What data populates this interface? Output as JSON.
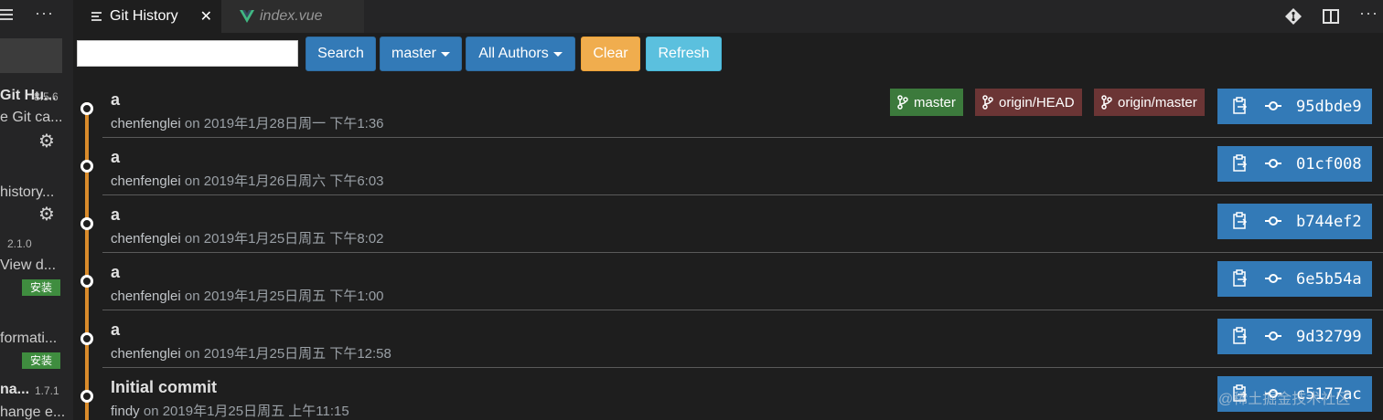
{
  "sidebar": {
    "extensions": [
      {
        "name": "Git Hu...",
        "version": "8.5.6",
        "description": "e Git ca...",
        "has_gear": true
      },
      {
        "name": "",
        "version": "",
        "description": "history...",
        "has_gear": true
      },
      {
        "name": "",
        "version": "2.1.0",
        "description": "View d...",
        "install_label": "安装"
      },
      {
        "name": "",
        "version": "",
        "description": "formati...",
        "install_label": "安装"
      },
      {
        "name": "na...",
        "version": "1.7.1",
        "description": "hange e..."
      }
    ]
  },
  "tabs": [
    {
      "label": "Git History",
      "active": true,
      "icon": "lines-icon",
      "closable": true
    },
    {
      "label": "index.vue",
      "active": false,
      "icon": "vue-icon"
    }
  ],
  "toolbar": {
    "search_value": "",
    "search_label": "Search",
    "branch_label": "master",
    "authors_label": "All Authors",
    "clear_label": "Clear",
    "refresh_label": "Refresh"
  },
  "refs_labels": {
    "local": "master",
    "head": "origin/HEAD",
    "remote": "origin/master"
  },
  "commits": [
    {
      "message": "a",
      "author": "chenfenglei",
      "on": "on",
      "date": "2019年1月28日周一 下午1:36",
      "hash": "95dbde9"
    },
    {
      "message": "a",
      "author": "chenfenglei",
      "on": "on",
      "date": "2019年1月26日周六 下午6:03",
      "hash": "01cf008"
    },
    {
      "message": "a",
      "author": "chenfenglei",
      "on": "on",
      "date": "2019年1月25日周五 下午8:02",
      "hash": "b744ef2"
    },
    {
      "message": "a",
      "author": "chenfenglei",
      "on": "on",
      "date": "2019年1月25日周五 下午1:00",
      "hash": "6e5b54a"
    },
    {
      "message": "a",
      "author": "chenfenglei",
      "on": "on",
      "date": "2019年1月25日周五 下午12:58",
      "hash": "9d32799"
    },
    {
      "message": "Initial commit",
      "author": "findy",
      "on": "on",
      "date": "2019年1月25日周五 上午11:15",
      "hash": "c5177ac"
    }
  ],
  "watermark": "@稀土掘金技术社区",
  "colors": {
    "accent_blue": "#337ab7",
    "warning": "#f0ad4e",
    "info": "#5bc0de",
    "graph_line": "#d98b2b",
    "ref_local": "#3c7a3c",
    "ref_remote": "#6b3535"
  }
}
